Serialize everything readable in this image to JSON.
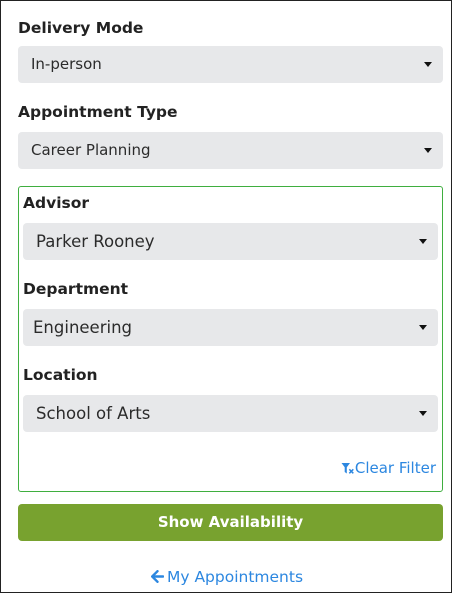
{
  "delivery_mode": {
    "label": "Delivery Mode",
    "value": "In-person"
  },
  "appointment_type": {
    "label": "Appointment Type",
    "value": "Career Planning"
  },
  "filters": {
    "advisor": {
      "label": "Advisor",
      "value": "Parker Rooney"
    },
    "department": {
      "label": "Department",
      "value": "Engineering"
    },
    "location": {
      "label": "Location",
      "value": "School of Arts"
    },
    "clear_label": "Clear Filter",
    "clear_icon": "filter-clear-icon"
  },
  "actions": {
    "show_availability_label": "Show Availability",
    "my_appointments_label": "My Appointments",
    "back_icon": "arrow-left-icon"
  },
  "colors": {
    "accent_blue": "#2c87e0",
    "button_green": "#78a22f",
    "filter_border_green": "#3fae3f",
    "select_bg": "#e7e8ea"
  }
}
